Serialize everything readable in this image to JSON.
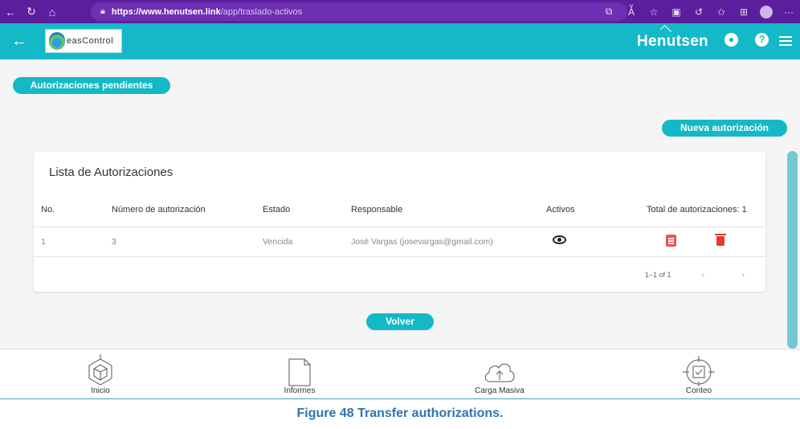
{
  "browser": {
    "url_host": "https://www.henutsen.link",
    "url_path": "/app/traslado-activos",
    "more_label": "···"
  },
  "header": {
    "logo_text": "easControl",
    "brand": "Henutsen",
    "help_label": "?"
  },
  "page": {
    "section_title": "Autorizaciones pendientes",
    "new_button": "Nueva autorización",
    "back_button": "Volver"
  },
  "table": {
    "title": "Lista de Autorizaciones",
    "headers": [
      "No.",
      "Número de autorización",
      "Estado",
      "Responsable",
      "Activos",
      "Total de autorizaciones: 1"
    ],
    "rows": [
      {
        "no": "1",
        "numero": "3",
        "estado": "Vencida",
        "responsable": "José Vargas (josevargas@gmail.com)"
      }
    ],
    "pagination": "1–1 of 1"
  },
  "bottom_nav": {
    "items": [
      {
        "label": "Inicio",
        "icon": "cube-icon"
      },
      {
        "label": "Informes",
        "icon": "document-icon"
      },
      {
        "label": "Carga Masiva",
        "icon": "cloud-upload-icon"
      },
      {
        "label": "Conteo",
        "icon": "crosshair-check-icon"
      }
    ]
  },
  "caption": "Figure 48 Transfer authorizations.",
  "colors": {
    "accent": "#15b8c6",
    "browser": "#5b1f9e",
    "danger": "#e53935",
    "caption": "#2e74b5"
  }
}
